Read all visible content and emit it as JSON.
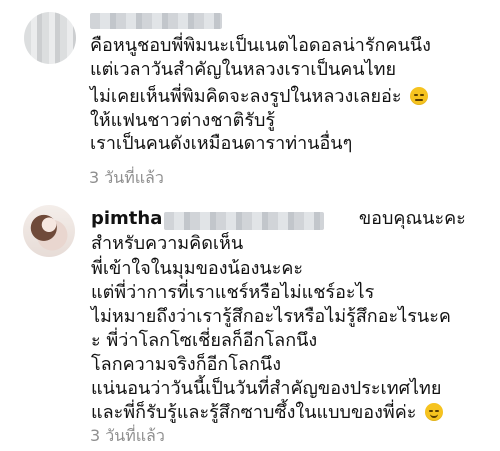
{
  "comments": [
    {
      "username": "",
      "lines": [
        "คือหนูชอบพี่พิมนะเป็นเนตไอดอลน่ารักคนนึง",
        "แต่เวลาวันสำคัญในหลวงเราเป็นคนไทย",
        "ไม่เคยเห็นพี่พิมคิดจะลงรูปในหลวงเลยอ่ะ",
        "ให้แฟนชาวต่างชาติรับรู้",
        "เราเป็นคนดังเหมือนดาราท่านอื่นๆ"
      ],
      "emoji_line_index": 2,
      "emoji_name": "unamused-face-icon",
      "time": "3 วันที่แล้ว"
    },
    {
      "username": "pimtha",
      "lines": [
        "ขอบคุณนะคะ",
        "สำหรับความคิดเห็น",
        "พี่เข้าใจในมุมของน้องนะคะ",
        "แต่พี่ว่าการที่เราแชร์หรือไม่แชร์อะไร",
        "ไม่หมายถึงว่าเรารู้สึกอะไรหรือไม่รู้สึกอะไรนะค",
        "ะ พี่ว่าโลกโซเชี่ยลก็อีกโลกนึง",
        "โลกความจริงก็อีกโลกนึง",
        "แน่นอนว่าวันนี้เป็นวันที่สำคัญของประเทศไทย",
        "และพี่ก็รับรู้และรู้สึกซาบซึ้งในแบบของพี่ค่ะ"
      ],
      "emoji_line_index": 8,
      "emoji_name": "smiling-face-icon",
      "time": "3 วันที่แล้ว"
    }
  ]
}
